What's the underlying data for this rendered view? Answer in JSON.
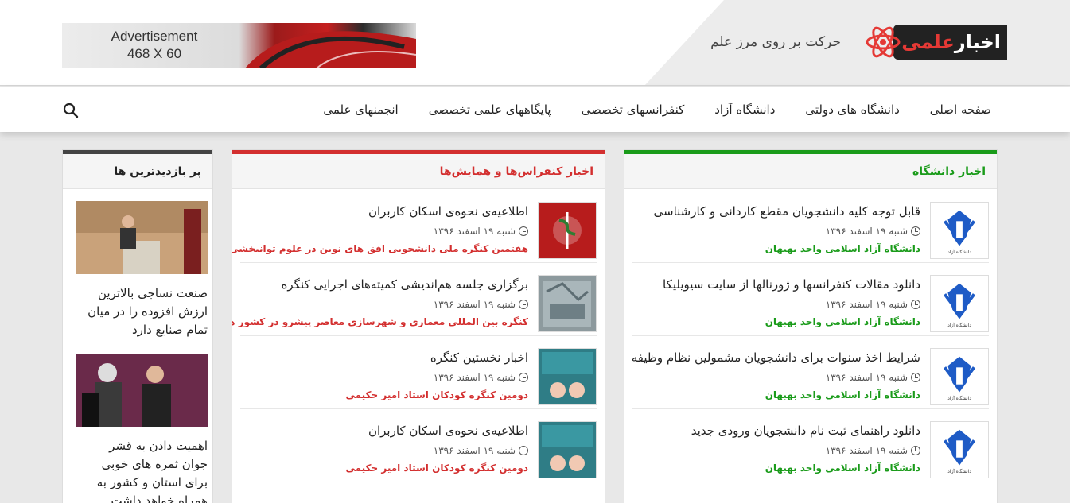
{
  "header": {
    "logo_word1": "اخبار",
    "logo_word2": "علمی",
    "slogan": "حرکت بر روی مرز علم",
    "ad_line1": "Advertisement",
    "ad_line2": "468 X 60"
  },
  "nav": {
    "items": [
      "صفحه اصلی",
      "دانشگاه های دولتی",
      "دانشگاه آزاد",
      "کنفرانسهای تخصصی",
      "پایگاههای علمی تخصصی",
      "انجمنهای علمی"
    ]
  },
  "colors": {
    "green": "#1a9b1a",
    "red": "#d32f2f",
    "dark": "#444444"
  },
  "university_news": {
    "heading": "اخبار دانشگاه",
    "items": [
      {
        "title": "قابل توجه کلیه دانشجویان مقطع کاردانی و کارشناسی",
        "date": "شنبه ۱۹ اسفند ۱۳۹۶",
        "source": "دانشگاه آزاد اسلامی واحد بهبهان"
      },
      {
        "title": "دانلود مقالات کنفرانسها و ژورنالها از سایت سیویلیکا",
        "date": "شنبه ۱۹ اسفند ۱۳۹۶",
        "source": "دانشگاه آزاد اسلامی واحد بهبهان"
      },
      {
        "title": "شرایط اخذ سنوات برای دانشجویان مشمولین نظام وظیفه",
        "date": "شنبه ۱۹ اسفند ۱۳۹۶",
        "source": "دانشگاه آزاد اسلامی واحد بهبهان"
      },
      {
        "title": "دانلود راهنمای ثبت نام دانشجویان ورودی جدید",
        "date": "شنبه ۱۹ اسفند ۱۳۹۶",
        "source": "دانشگاه آزاد اسلامی واحد بهبهان"
      }
    ]
  },
  "conference_news": {
    "heading": "اخبار کنفراس‌ها و همایش‌ها",
    "items": [
      {
        "title": "اطلاعیه‌ی نحوه‌ی اسکان کاربران",
        "date": "شنبه ۱۹ اسفند ۱۳۹۶",
        "source": "هفتمین کنگره ملی دانشجویی افق های نوین در علوم توانبخشی"
      },
      {
        "title": "برگزاری جلسه هم‌اندیشی کمیته‌های اجرایی کنگره",
        "date": "شنبه ۱۹ اسفند ۱۳۹۶",
        "source": "کنگره بین المللی معماری و شهرسازی معاصر پیشرو در کشور های اسلامی"
      },
      {
        "title": "اخبار نخستین کنگره",
        "date": "شنبه ۱۹ اسفند ۱۳۹۶",
        "source": "دومین کنگره کودکان استاد امیر حکیمی"
      },
      {
        "title": "اطلاعیه‌ی نحوه‌ی اسکان کاربران",
        "date": "شنبه ۱۹ اسفند ۱۳۹۶",
        "source": "دومین کنگره کودکان استاد امیر حکیمی"
      }
    ]
  },
  "most_visited": {
    "heading": "پر بازدیدترین ها",
    "items": [
      {
        "title": "صنعت نساجی بالاترین ارزش افزوده را در میان تمام صنایع دارد"
      },
      {
        "title": "اهمیت دادن به قشر جوان ثمره های خوبی برای استان و کشور به همراه خواهد داشت"
      }
    ]
  }
}
